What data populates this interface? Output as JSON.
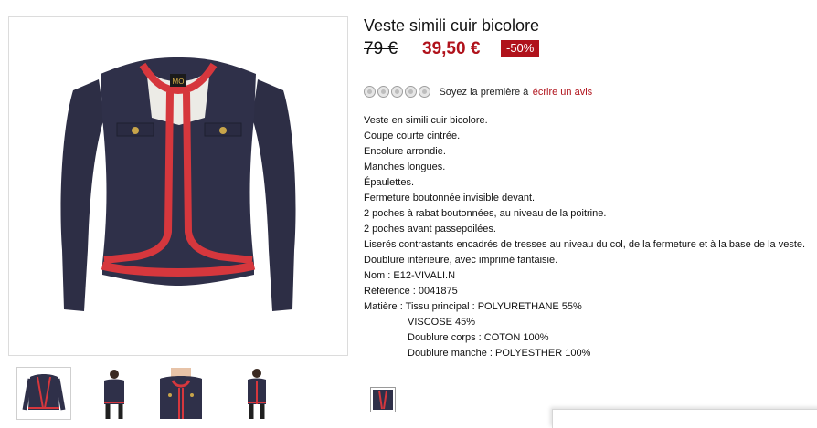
{
  "product": {
    "title": "Veste simili cuir bicolore",
    "old_price": "79 €",
    "new_price": "39,50 €",
    "discount": "-50%",
    "brand_logo_text": "MO",
    "accent_color": "#b0121b"
  },
  "rating": {
    "stars_filled": 0,
    "stars_total": 5,
    "prompt_text": "Soyez la première à",
    "link_text": "écrire un avis"
  },
  "description": {
    "lines": [
      "Veste en simili cuir bicolore.",
      "Coupe courte cintrée.",
      "Encolure arrondie.",
      "Manches longues.",
      "Épaulettes.",
      "Fermeture boutonnée invisible devant.",
      "2 poches à rabat boutonnées, au niveau de la poitrine.",
      "2 poches avant passepoilées.",
      "Liserés contrastants encadrés de tresses au niveau du col, de la fermeture et à la base de la veste.",
      "Doublure intérieure, avec imprimé fantaisie.",
      "Nom : E12-VIVALI.N",
      "Référence : 0041875",
      "Matière : Tissu principal : POLYURETHANE 55%"
    ],
    "material_lines": [
      "VISCOSE 45%",
      "Doublure corps : COTON 100%",
      "Doublure manche : POLYESTHER 100%"
    ]
  },
  "gallery": {
    "thumbnails": [
      "front-view",
      "model-back-view",
      "model-front-closeup",
      "model-side-view"
    ],
    "active_index": 0
  }
}
